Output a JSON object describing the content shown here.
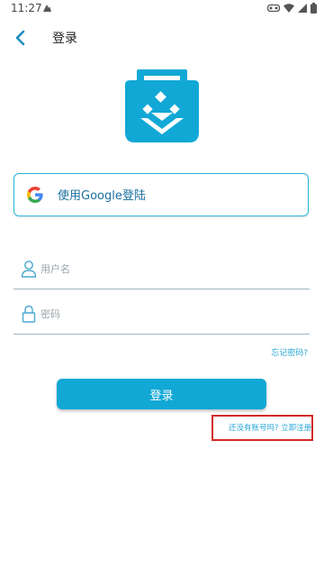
{
  "status_bar": {
    "time": "11:27",
    "icons": [
      "notification-icon",
      "vr-icon",
      "wifi-icon",
      "signal-icon",
      "battery-icon"
    ]
  },
  "app_bar": {
    "back_icon": "chevron-left-icon",
    "title": "登录"
  },
  "logo": {
    "icon": "shopping-bag-logo",
    "color": "#11a8d6"
  },
  "google_login": {
    "icon": "google-icon",
    "label": "使用Google登陆"
  },
  "form": {
    "username": {
      "icon": "user-icon",
      "placeholder": "用户名",
      "value": ""
    },
    "password": {
      "icon": "lock-icon",
      "placeholder": "密码",
      "value": ""
    },
    "forgot_password": "忘记密码?"
  },
  "login_button": {
    "label": "登录"
  },
  "register": {
    "label": "还没有账号吗? 立即注册",
    "highlight_color": "#d32a2a"
  },
  "colors": {
    "accent": "#11a8d6",
    "link": "#29a7d4"
  }
}
